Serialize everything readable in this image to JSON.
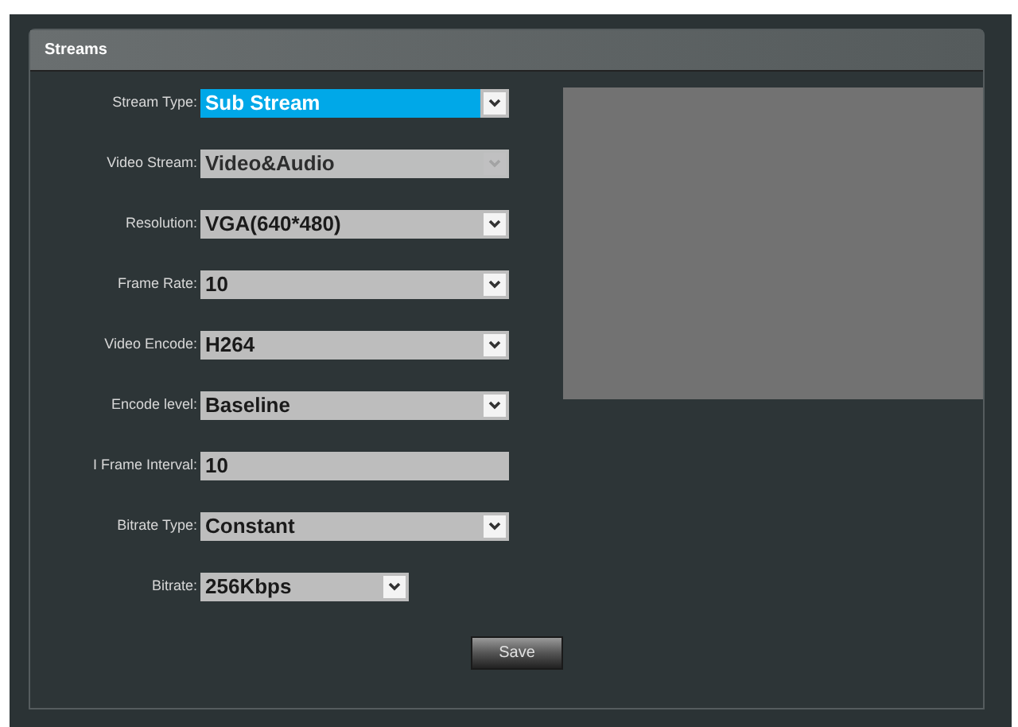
{
  "panel": {
    "title": "Streams"
  },
  "fields": [
    {
      "label": "Stream Type:",
      "kind": "select",
      "value": "Sub Stream",
      "highlighted": true,
      "disabled": false
    },
    {
      "label": "Video Stream:",
      "kind": "select",
      "value": "Video&Audio",
      "highlighted": false,
      "disabled": true
    },
    {
      "label": "Resolution:",
      "kind": "select",
      "value": "VGA(640*480)",
      "highlighted": false,
      "disabled": false
    },
    {
      "label": "Frame Rate:",
      "kind": "select",
      "value": "10",
      "highlighted": false,
      "disabled": false
    },
    {
      "label": "Video Encode:",
      "kind": "select",
      "value": "H264",
      "highlighted": false,
      "disabled": false
    },
    {
      "label": "Encode level:",
      "kind": "select",
      "value": "Baseline",
      "highlighted": false,
      "disabled": false
    },
    {
      "label": "I Frame Interval:",
      "kind": "text",
      "value": "10",
      "highlighted": false,
      "disabled": false
    },
    {
      "label": "Bitrate Type:",
      "kind": "select",
      "value": "Constant",
      "highlighted": false,
      "disabled": false
    },
    {
      "label": "Bitrate:",
      "kind": "short_select",
      "value": "256Kbps",
      "highlighted": false,
      "disabled": false
    }
  ],
  "preview": {
    "kind": "video_preview"
  },
  "buttons": [
    {
      "label": "Save"
    }
  ]
}
